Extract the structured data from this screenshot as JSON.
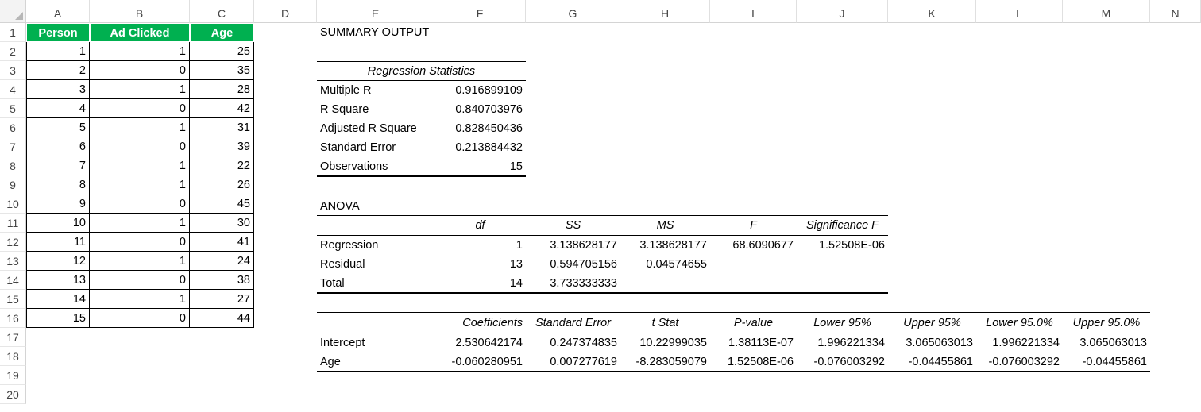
{
  "columns": [
    "A",
    "B",
    "C",
    "D",
    "E",
    "F",
    "G",
    "H",
    "I",
    "J",
    "K",
    "L",
    "M",
    "N"
  ],
  "rows": [
    "1",
    "2",
    "3",
    "4",
    "5",
    "6",
    "7",
    "8",
    "9",
    "10",
    "11",
    "12",
    "13",
    "14",
    "15",
    "16",
    "17",
    "18",
    "19",
    "20"
  ],
  "table": {
    "headers": [
      "Person",
      "Ad Clicked",
      "Age"
    ],
    "person": [
      "1",
      "2",
      "3",
      "4",
      "5",
      "6",
      "7",
      "8",
      "9",
      "10",
      "11",
      "12",
      "13",
      "14",
      "15"
    ],
    "ad_clicked": [
      "1",
      "0",
      "1",
      "0",
      "1",
      "0",
      "1",
      "1",
      "0",
      "1",
      "0",
      "1",
      "0",
      "1",
      "0"
    ],
    "age": [
      "25",
      "35",
      "28",
      "42",
      "31",
      "39",
      "22",
      "26",
      "45",
      "30",
      "41",
      "24",
      "38",
      "27",
      "44"
    ]
  },
  "summary": {
    "title": "SUMMARY OUTPUT",
    "regstats_title": "Regression Statistics",
    "regstats": [
      {
        "label": "Multiple R",
        "value": "0.916899109"
      },
      {
        "label": "R Square",
        "value": "0.840703976"
      },
      {
        "label": "Adjusted R Square",
        "value": "0.828450436"
      },
      {
        "label": "Standard Error",
        "value": "0.213884432"
      },
      {
        "label": "Observations",
        "value": "15"
      }
    ],
    "anova_title": "ANOVA",
    "anova_headers": [
      "df",
      "SS",
      "MS",
      "F",
      "Significance F"
    ],
    "anova_rows": [
      {
        "label": "Regression",
        "df": "1",
        "ss": "3.138628177",
        "ms": "3.138628177",
        "f": "68.6090677",
        "sig": "1.52508E-06"
      },
      {
        "label": "Residual",
        "df": "13",
        "ss": "0.594705156",
        "ms": "0.04574655",
        "f": "",
        "sig": ""
      },
      {
        "label": "Total",
        "df": "14",
        "ss": "3.733333333",
        "ms": "",
        "f": "",
        "sig": ""
      }
    ],
    "coef_headers": [
      "Coefficients",
      "Standard Error",
      "t Stat",
      "P-value",
      "Lower 95%",
      "Upper 95%",
      "Lower 95.0%",
      "Upper 95.0%"
    ],
    "coef_rows": [
      {
        "label": "Intercept",
        "values": [
          "2.530642174",
          "0.247374835",
          "10.22999035",
          "1.38113E-07",
          "1.996221334",
          "3.065063013",
          "1.996221334",
          "3.065063013"
        ]
      },
      {
        "label": "Age",
        "values": [
          "-0.060280951",
          "0.007277619",
          "-8.283059079",
          "1.52508E-06",
          "-0.076003292",
          "-0.04455861",
          "-0.076003292",
          "-0.04455861"
        ]
      }
    ]
  }
}
